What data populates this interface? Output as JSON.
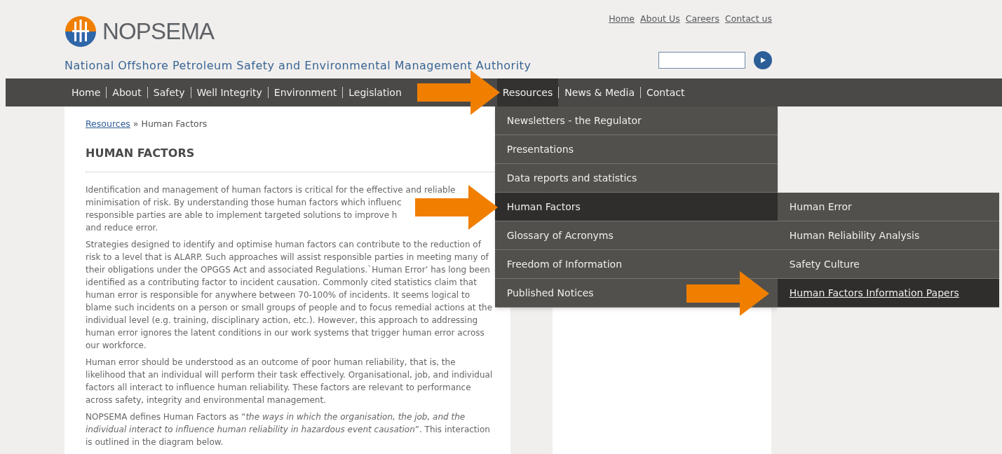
{
  "header": {
    "logo_text": "NOPSEMA",
    "tagline": "National Offshore Petroleum Safety and Environmental Management Authority",
    "top_links": [
      "Home",
      "About Us",
      "Careers",
      "Contact us"
    ]
  },
  "nav": [
    {
      "label": "Home",
      "selected": false
    },
    {
      "label": "About",
      "selected": false
    },
    {
      "label": "Safety",
      "selected": false
    },
    {
      "label": "Well Integrity",
      "selected": false
    },
    {
      "label": "Environment",
      "selected": false
    },
    {
      "label": "Legislation",
      "selected": false
    },
    {
      "label": "Resources",
      "selected": true
    },
    {
      "label": "News & Media",
      "selected": false
    },
    {
      "label": "Contact",
      "selected": false
    }
  ],
  "dropdown": [
    {
      "label": "Newsletters - the Regulator",
      "selected": false
    },
    {
      "label": "Presentations",
      "selected": false
    },
    {
      "label": "Data reports and statistics",
      "selected": false
    },
    {
      "label": "Human Factors",
      "selected": true,
      "children": [
        {
          "label": "Human Error",
          "selected": false
        },
        {
          "label": "Human Reliability Analysis",
          "selected": false
        },
        {
          "label": "Safety Culture",
          "selected": false
        },
        {
          "label": "Human Factors Information Papers",
          "selected": true
        }
      ]
    },
    {
      "label": "Glossary of Acronyms",
      "selected": false
    },
    {
      "label": "Freedom of Information",
      "selected": false
    },
    {
      "label": "Published Notices",
      "selected": false
    }
  ],
  "breadcrumb": {
    "link": "Resources",
    "separator": "»",
    "current": "Human Factors"
  },
  "title": "HUMAN FACTORS",
  "paragraphs": [
    {
      "kind": "lines",
      "lines": [
        "Identification and management of human factors is critical for the effective and reliable",
        "minimisation of risk. By understanding those human factors which influenc",
        "responsible parties are able to implement targeted solutions to improve h",
        "and reduce error."
      ]
    },
    {
      "kind": "text",
      "text": "Strategies designed to identify and optimise human factors can contribute to the reduction of risk to a level that is ALARP. Such approaches will assist responsible parties in meeting many of their obligations under the OPGGS Act and associated Regulations.`Human Error’ has long been identified as a contributing factor to incident causation. Commonly cited statistics claim that human error is responsible for anywhere between 70-100% of incidents.  It seems logical to blame such incidents on a person or small groups of people and to focus remedial actions at the individual level (e.g. training, disciplinary action, etc.). However, this approach to addressing human error ignores the latent conditions in our work systems that trigger human error across our workforce."
    },
    {
      "kind": "text",
      "text": "Human error should be understood as an outcome of poor human reliability, that is, the likelihood that an individual will perform their task effectively. Organisational, job, and individual factors all interact to influence human reliability. These factors are relevant to performance across safety, integrity and environmental management."
    },
    {
      "kind": "text",
      "text": "NOPSEMA defines Human Factors as “*the ways in which the organisation, the job, and the individual interact to influence human reliability in hazardous event causation*”. This interaction is outlined in the diagram below."
    }
  ]
}
